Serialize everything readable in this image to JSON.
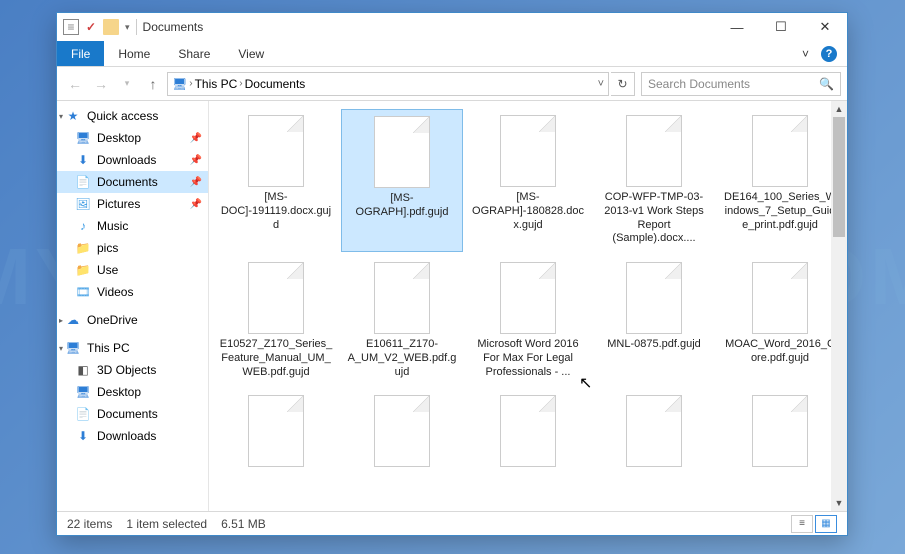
{
  "title": "Documents",
  "ribbon": {
    "file": "File",
    "tabs": [
      "Home",
      "Share",
      "View"
    ],
    "chevron": "˅"
  },
  "breadcrumb": [
    "This PC",
    "Documents"
  ],
  "search": {
    "placeholder": "Search Documents"
  },
  "sidebar": {
    "quick_access": {
      "label": "Quick access",
      "items": [
        {
          "label": "Desktop",
          "pin": true,
          "iconcls": "i-desk",
          "glyph": "🖥"
        },
        {
          "label": "Downloads",
          "pin": true,
          "iconcls": "i-down",
          "glyph": "⬇"
        },
        {
          "label": "Documents",
          "pin": true,
          "iconcls": "i-docs",
          "glyph": "📄",
          "selected": true
        },
        {
          "label": "Pictures",
          "pin": true,
          "iconcls": "i-pics",
          "glyph": "🖼"
        },
        {
          "label": "Music",
          "iconcls": "i-music",
          "glyph": "♪"
        },
        {
          "label": "pics",
          "iconcls": "i-folder",
          "glyph": "📁"
        },
        {
          "label": "Use",
          "iconcls": "i-folder",
          "glyph": "📁"
        },
        {
          "label": "Videos",
          "iconcls": "i-vid",
          "glyph": "🎞"
        }
      ]
    },
    "onedrive": {
      "label": "OneDrive"
    },
    "this_pc": {
      "label": "This PC",
      "items": [
        {
          "label": "3D Objects",
          "iconcls": "i-3d",
          "glyph": "◧"
        },
        {
          "label": "Desktop",
          "iconcls": "i-desk",
          "glyph": "🖥"
        },
        {
          "label": "Documents",
          "iconcls": "i-docs",
          "glyph": "📄"
        },
        {
          "label": "Downloads",
          "iconcls": "i-down",
          "glyph": "⬇"
        }
      ]
    }
  },
  "files": [
    {
      "name": "[MS-DOC]-191119.docx.gujd"
    },
    {
      "name": "[MS-OGRAPH].pdf.gujd",
      "selected": true
    },
    {
      "name": "[MS-OGRAPH]-180828.docx.gujd"
    },
    {
      "name": "COP-WFP-TMP-03-2013-v1 Work Steps Report (Sample).docx...."
    },
    {
      "name": "DE164_100_Series_Windows_7_Setup_Guide_print.pdf.gujd"
    },
    {
      "name": "E10527_Z170_Series_Feature_Manual_UM_WEB.pdf.gujd"
    },
    {
      "name": "E10611_Z170-A_UM_V2_WEB.pdf.gujd"
    },
    {
      "name": "Microsoft Word 2016 For Max For Legal Professionals - ..."
    },
    {
      "name": "MNL-0875.pdf.gujd"
    },
    {
      "name": "MOAC_Word_2016_Core.pdf.gujd"
    },
    {
      "name": ""
    },
    {
      "name": ""
    },
    {
      "name": ""
    },
    {
      "name": ""
    },
    {
      "name": ""
    }
  ],
  "status": {
    "count": "22 items",
    "selection": "1 item selected",
    "size": "6.51 MB"
  }
}
